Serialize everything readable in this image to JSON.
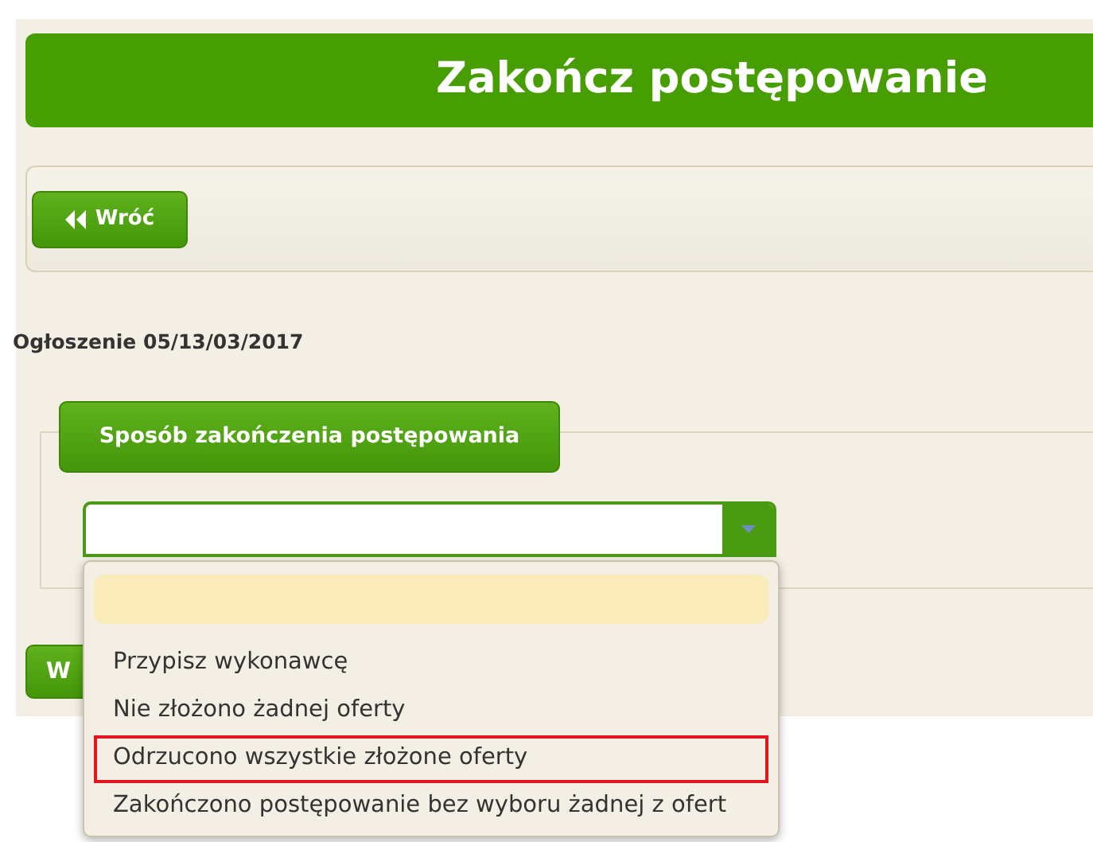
{
  "header": {
    "title": "Zakończ postępowanie"
  },
  "toolbar": {
    "back_button": {
      "label": "Wróć"
    }
  },
  "notice": "Ogłoszenie 05/13/03/2017",
  "section": {
    "legend": "Sposób zakończenia postępowania",
    "select": {
      "expanded": true,
      "options": [
        {
          "selected": true,
          "outlined": false
        },
        {
          "label": "Przypisz wykonawcę",
          "selected": false,
          "outlined": false
        },
        {
          "label": "Nie złożono żadnej oferty",
          "selected": false,
          "outlined": false
        },
        {
          "label": "Odrzucono wszystkie złożone oferty",
          "selected": false,
          "outlined": true
        },
        {
          "label": "Zakończono postępowanie bez wyboru żadnej z ofert",
          "selected": false,
          "outlined": false
        }
      ]
    }
  },
  "footer_button": {
    "label": "W"
  }
}
